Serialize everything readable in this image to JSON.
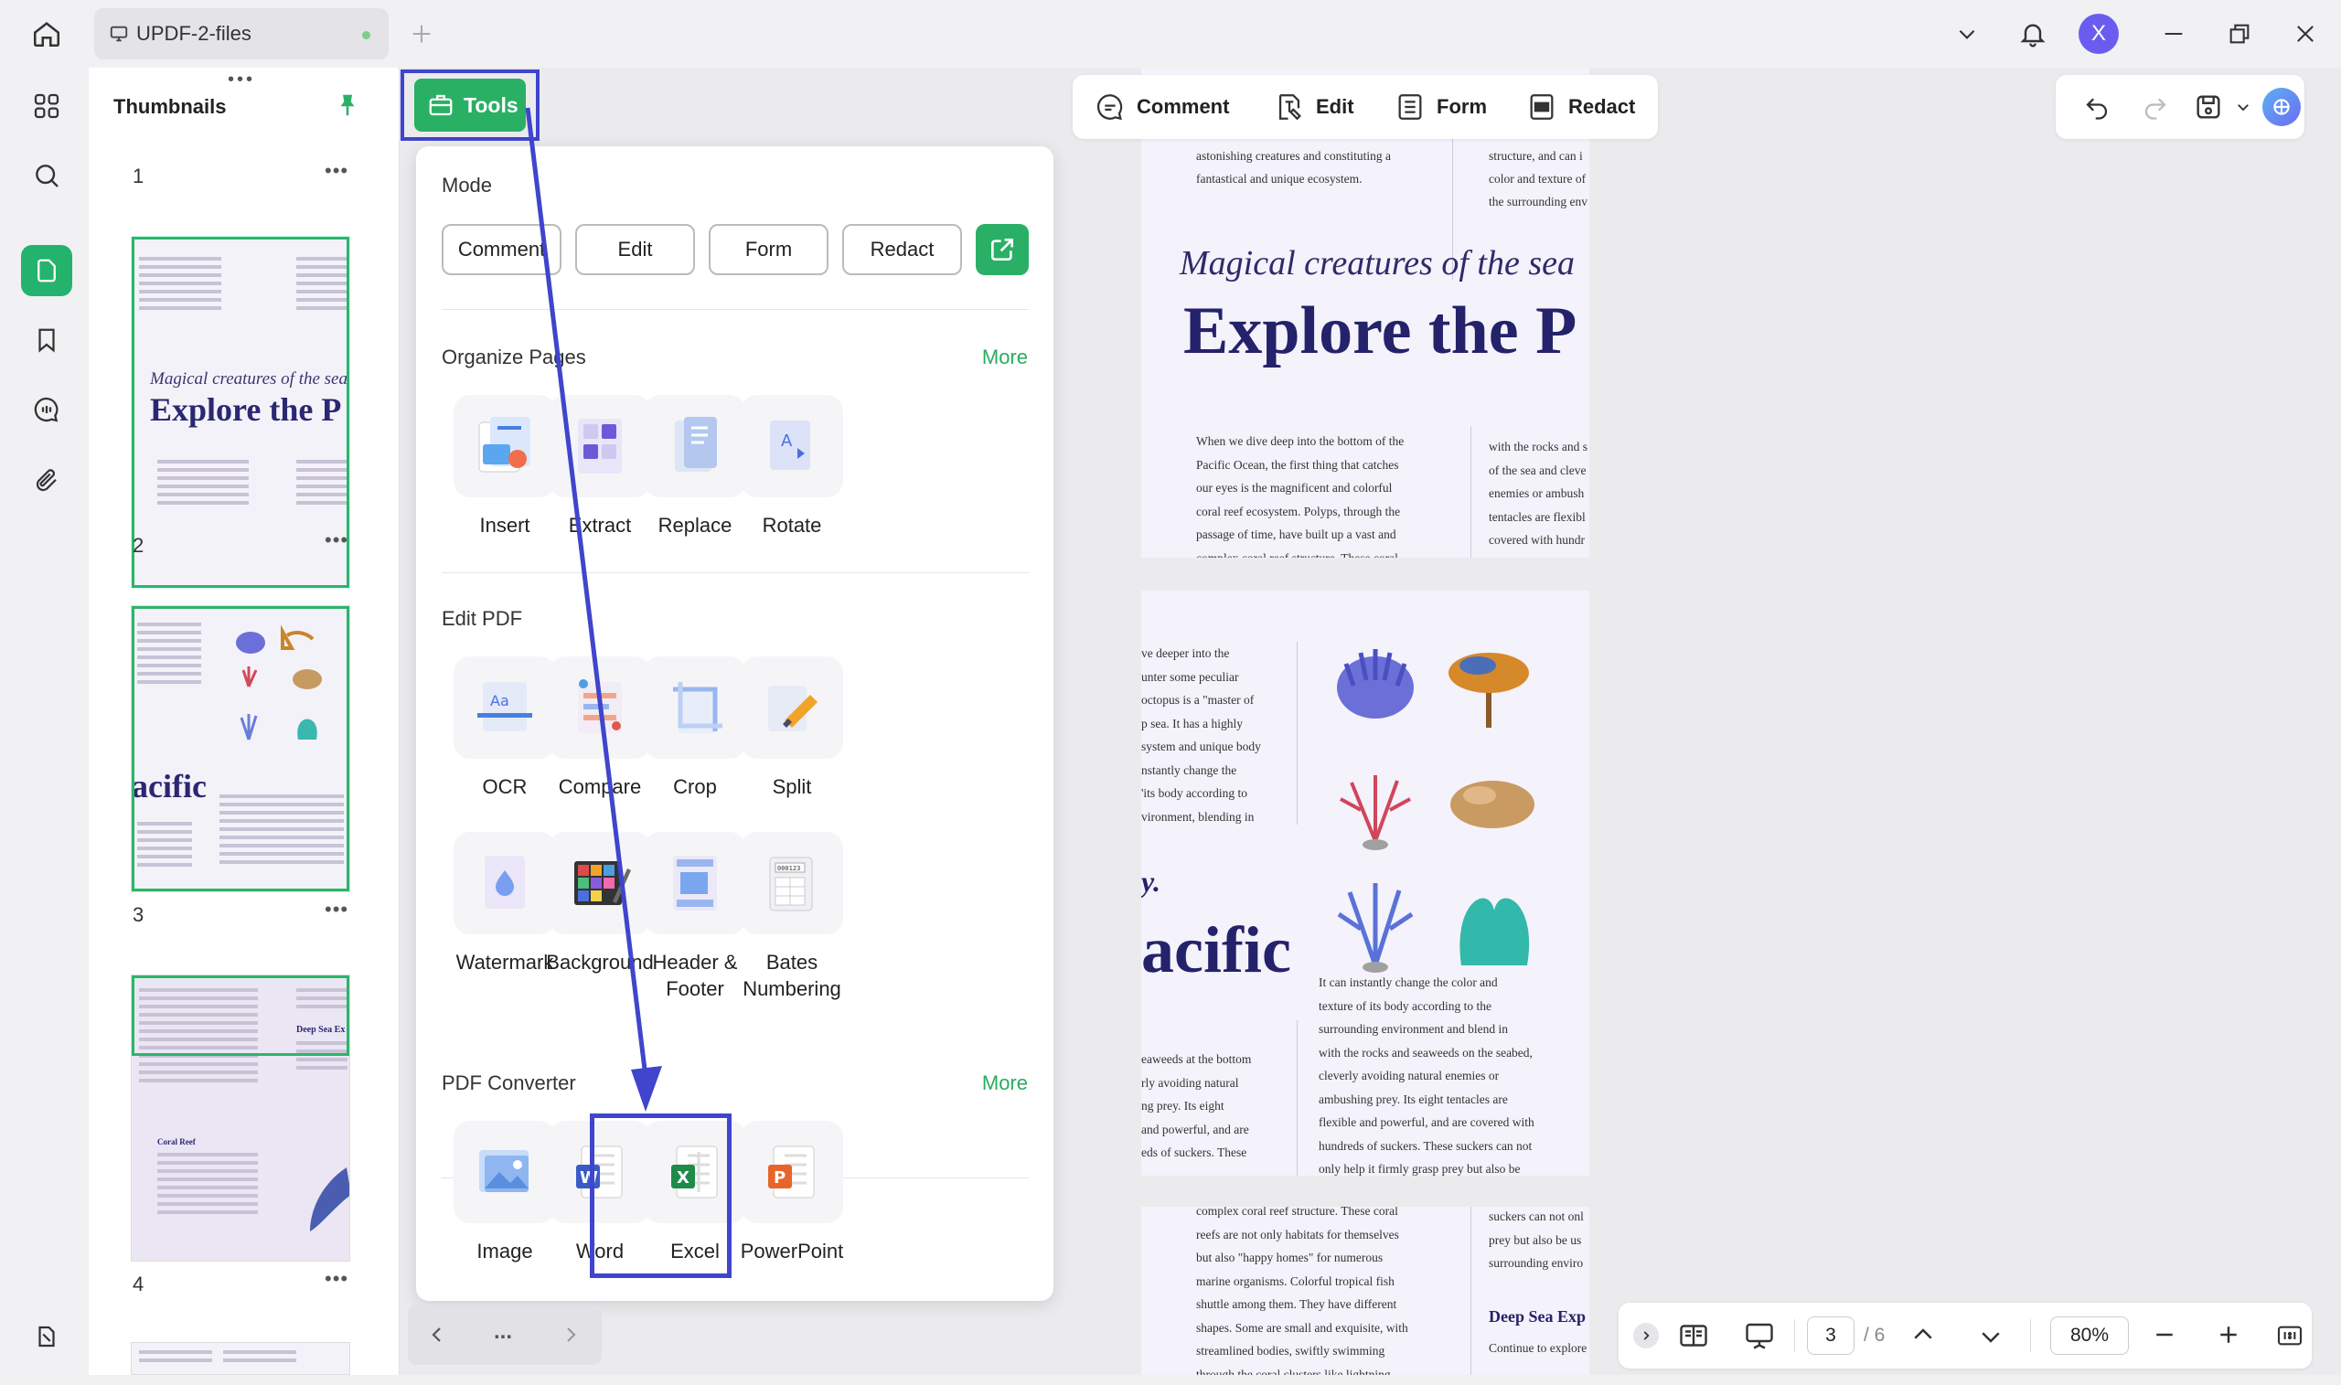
{
  "titlebar": {
    "tab_label": "UPDF-2-files",
    "avatar_letter": "X"
  },
  "thumbnails": {
    "title": "Thumbnails",
    "pages": [
      {
        "number": "1"
      },
      {
        "number": "2",
        "heading_italic": "Magical creatures of the sea",
        "heading_big": "Explore the P"
      },
      {
        "number": "3",
        "word": "acific"
      },
      {
        "number": "4",
        "sub1": "Coral Reef",
        "sub2": "Deep Sea Ex"
      }
    ]
  },
  "tools_button": {
    "label": "Tools"
  },
  "tools_menu": {
    "mode": {
      "title": "Mode",
      "buttons": [
        "Comment",
        "Edit",
        "Form",
        "Redact"
      ]
    },
    "organize": {
      "title": "Organize Pages",
      "more": "More",
      "tools": [
        {
          "label": "Insert",
          "icon": "insert-icon"
        },
        {
          "label": "Extract",
          "icon": "extract-icon"
        },
        {
          "label": "Replace",
          "icon": "replace-icon"
        },
        {
          "label": "Rotate",
          "icon": "rotate-icon"
        }
      ]
    },
    "edit_pdf": {
      "title": "Edit PDF",
      "tools": [
        {
          "label": "OCR",
          "icon": "ocr-icon"
        },
        {
          "label": "Compare",
          "icon": "compare-icon"
        },
        {
          "label": "Crop",
          "icon": "crop-icon"
        },
        {
          "label": "Split",
          "icon": "split-icon"
        },
        {
          "label": "Watermark",
          "icon": "watermark-icon"
        },
        {
          "label": "Background",
          "icon": "background-icon"
        },
        {
          "label": "Header & Footer",
          "icon": "header-footer-icon"
        },
        {
          "label": "Bates Numbering",
          "icon": "bates-numbering-icon"
        }
      ]
    },
    "converter": {
      "title": "PDF Converter",
      "more": "More",
      "tools": [
        {
          "label": "Image",
          "icon": "image-icon"
        },
        {
          "label": "Word",
          "icon": "word-icon"
        },
        {
          "label": "Excel",
          "icon": "excel-icon"
        },
        {
          "label": "PowerPoint",
          "icon": "powerpoint-icon"
        }
      ]
    }
  },
  "nav_pill": {
    "dots": "..."
  },
  "modebar": {
    "comment": "Comment",
    "edit": "Edit",
    "form": "Form",
    "redact": "Redact"
  },
  "document": {
    "p1_top_left": [
      "astonishing creatures and constituting a",
      "fantastical and unique ecosystem."
    ],
    "p1_top_right": [
      "structure, and can i",
      "color and texture of",
      "the surrounding env"
    ],
    "italic_title": "Magical creatures of the sea",
    "big_title": "Explore the P",
    "p1_left": [
      "When we dive deep into the bottom of the",
      "Pacific Ocean, the first thing that catches",
      "our eyes is the magnificent and colorful",
      "coral reef ecosystem. Polyps, through the",
      "passage of time, have built up a vast and",
      "complex coral reef structure. These coral"
    ],
    "p1_right": [
      "with the rocks and s",
      "of the sea and cleve",
      "enemies or ambush",
      "tentacles are flexibl",
      "covered with hundr"
    ],
    "p2_left": [
      "ve deeper into the",
      "unter some peculiar",
      "octopus is a \"master of",
      "p sea. It has a highly",
      "system and unique body",
      "nstantly change the",
      "'its body according to",
      "vironment, blending in"
    ],
    "p2_letter": "y.",
    "p2_word": "acific",
    "p2_bottom_left": [
      "eaweeds at the bottom",
      "rly avoiding natural",
      "ng prey. Its eight",
      "and powerful, and are",
      "eds of suckers. These"
    ],
    "p2_right": [
      "It can instantly change the color and",
      "texture of its body according to the",
      "surrounding environment and blend in",
      "with the rocks and seaweeds on the seabed,",
      "cleverly avoiding natural enemies or",
      "ambushing prey. Its eight tentacles are",
      "flexible and powerful, and are covered with",
      "hundreds of suckers. These suckers can not",
      "only help it firmly grasp prey but also be"
    ],
    "p3_left": [
      "complex coral reef structure. These coral",
      "reefs are not only habitats for themselves",
      "but also \"happy homes\" for numerous",
      "marine organisms. Colorful tropical fish",
      "shuttle among them. They have different",
      "shapes. Some are small and exquisite, with",
      "streamlined bodies, swiftly swimming",
      "through the coral clusters like lightning"
    ],
    "p3_right_top": [
      "suckers can not onl",
      "prey but also be us",
      "surrounding enviro"
    ],
    "p3_heading": "Deep Sea Exp",
    "p3_right_bottom": [
      "Continue to explore"
    ]
  },
  "bottombar": {
    "page_current": "3",
    "page_total": "/ 6",
    "zoom": "80%"
  },
  "colors": {
    "accent": "#2ab066",
    "highlight": "#3f45cc"
  }
}
